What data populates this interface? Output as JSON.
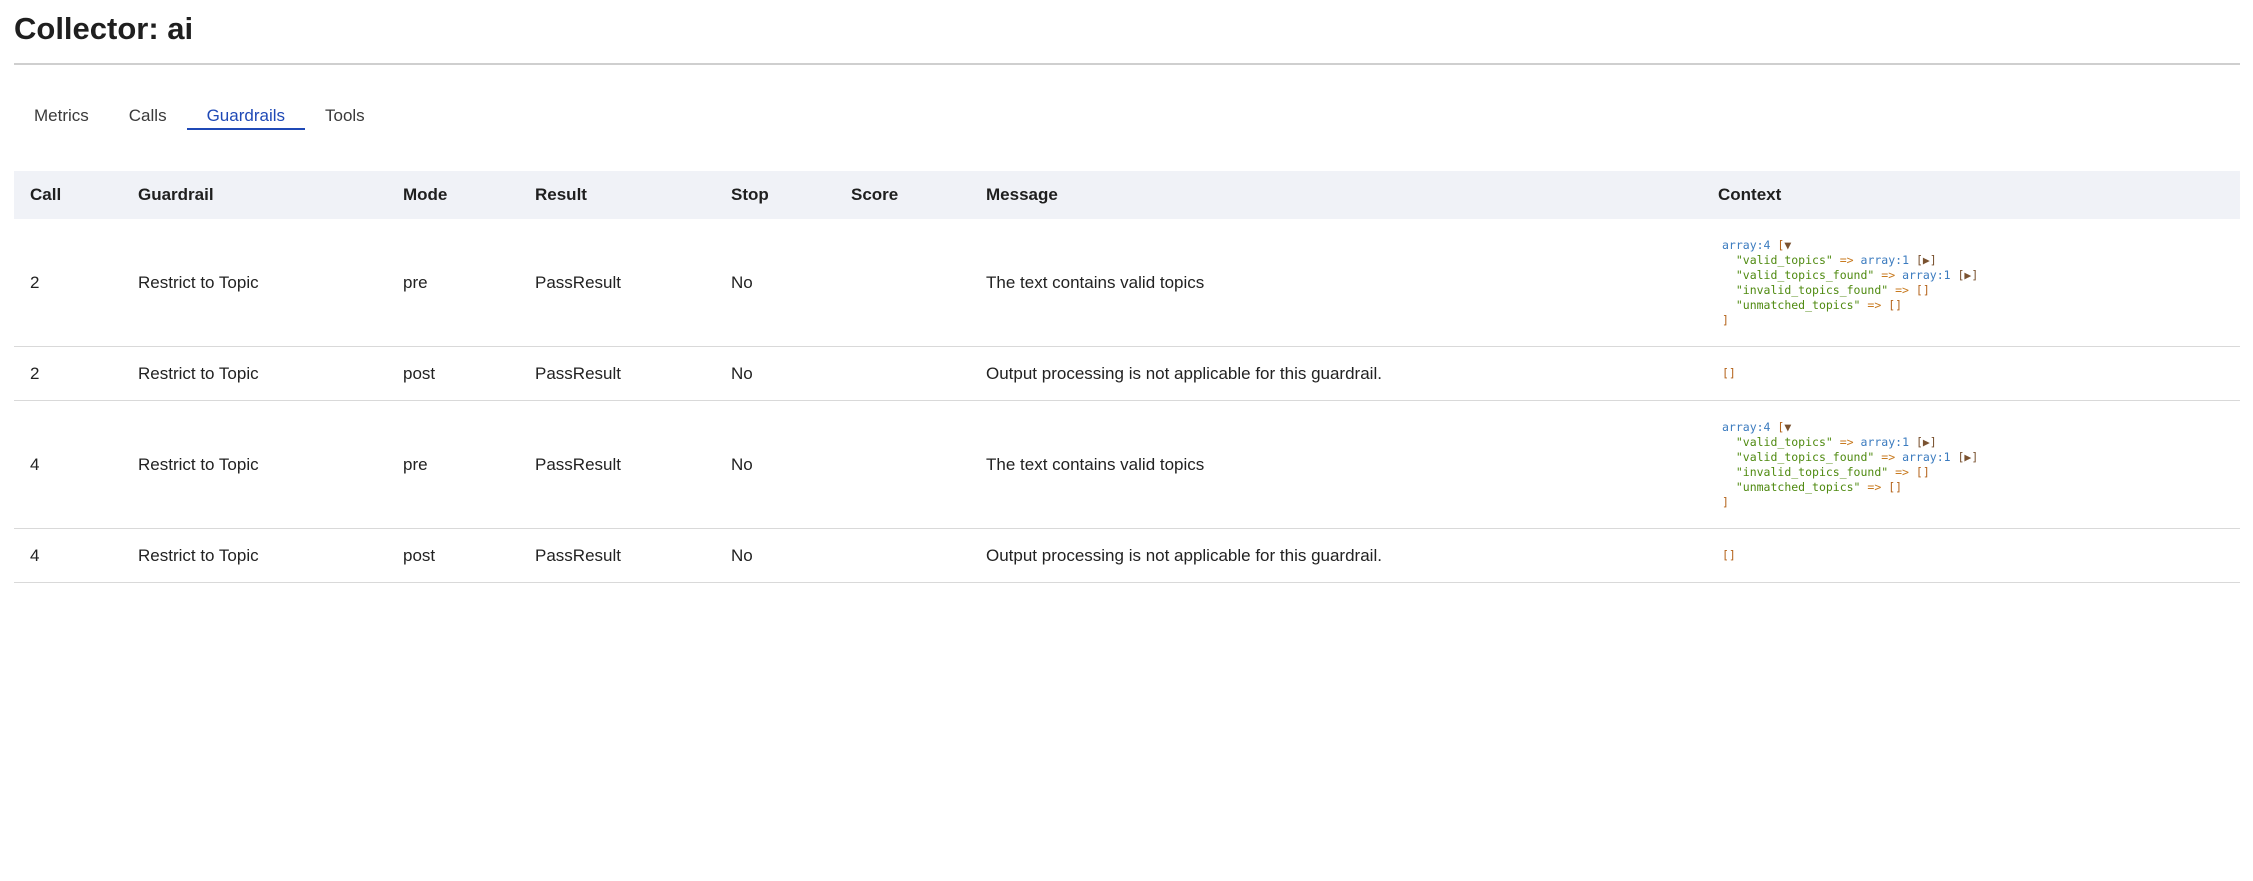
{
  "page": {
    "title": "Collector: ai"
  },
  "tabs": [
    {
      "label": "Metrics",
      "active": false
    },
    {
      "label": "Calls",
      "active": false
    },
    {
      "label": "Guardrails",
      "active": true
    },
    {
      "label": "Tools",
      "active": false
    }
  ],
  "table": {
    "columns": [
      "Call",
      "Guardrail",
      "Mode",
      "Result",
      "Stop",
      "Score",
      "Message",
      "Context"
    ],
    "rows": [
      {
        "call": "2",
        "guardrail": "Restrict to Topic",
        "mode": "pre",
        "result": "PassResult",
        "stop": "No",
        "score": "",
        "message": "The text contains valid topics",
        "context": {
          "type": "array:4",
          "open": "[",
          "toggle": "▼",
          "close": "]",
          "entries": [
            {
              "key": "\"valid_topics\"",
              "arrow": "=>",
              "type": "array:1",
              "value": "[▶]"
            },
            {
              "key": "\"valid_topics_found\"",
              "arrow": "=>",
              "type": "array:1",
              "value": "[▶]"
            },
            {
              "key": "\"invalid_topics_found\"",
              "arrow": "=>",
              "type": "",
              "value": "[]"
            },
            {
              "key": "\"unmatched_topics\"",
              "arrow": "=>",
              "type": "",
              "value": "[]"
            }
          ]
        }
      },
      {
        "call": "2",
        "guardrail": "Restrict to Topic",
        "mode": "post",
        "result": "PassResult",
        "stop": "No",
        "score": "",
        "message": "Output processing is not applicable for this guardrail.",
        "context_empty": "[]"
      },
      {
        "call": "4",
        "guardrail": "Restrict to Topic",
        "mode": "pre",
        "result": "PassResult",
        "stop": "No",
        "score": "",
        "message": "The text contains valid topics",
        "context": {
          "type": "array:4",
          "open": "[",
          "toggle": "▼",
          "close": "]",
          "entries": [
            {
              "key": "\"valid_topics\"",
              "arrow": "=>",
              "type": "array:1",
              "value": "[▶]"
            },
            {
              "key": "\"valid_topics_found\"",
              "arrow": "=>",
              "type": "array:1",
              "value": "[▶]"
            },
            {
              "key": "\"invalid_topics_found\"",
              "arrow": "=>",
              "type": "",
              "value": "[]"
            },
            {
              "key": "\"unmatched_topics\"",
              "arrow": "=>",
              "type": "",
              "value": "[]"
            }
          ]
        }
      },
      {
        "call": "4",
        "guardrail": "Restrict to Topic",
        "mode": "post",
        "result": "PassResult",
        "stop": "No",
        "score": "",
        "message": "Output processing is not applicable for this guardrail.",
        "context_empty": "[]"
      }
    ]
  },
  "colors": {
    "accent": "#1f49b6",
    "header_bg": "#f0f2f7",
    "dump_type": "#3b7bbf",
    "dump_key": "#4f8a10",
    "dump_arrow": "#c87a1f"
  }
}
